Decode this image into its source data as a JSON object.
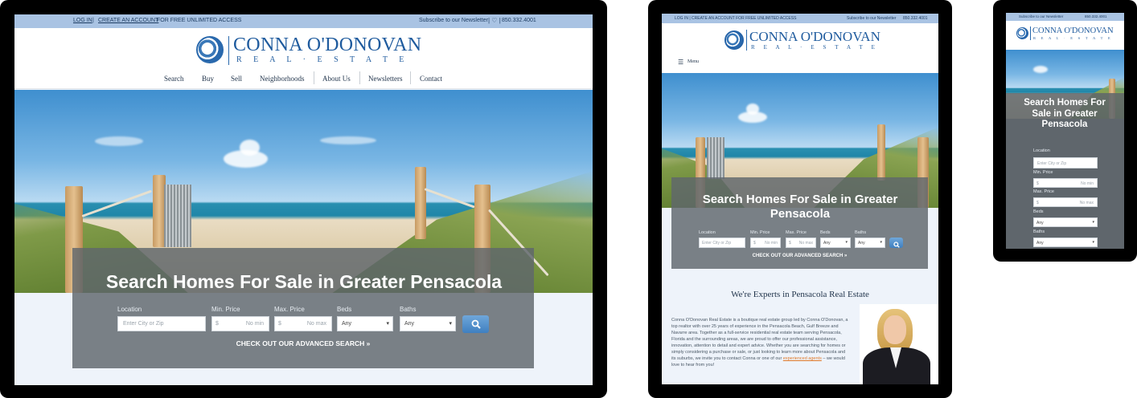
{
  "topbar": {
    "login": "LOG IN",
    "create_account": "CREATE AN ACCOUNT",
    "unlimited": "FOR FREE UNLIMITED ACCESS",
    "newsletter": "Subscribe to our Newsletter",
    "phone": "850.332.4001",
    "mobile_combined": "LOG IN | CREATE AN ACCOUNT FOR FREE UNLIMITED ACCESS"
  },
  "logo": {
    "name": "CONNA O'DONOVAN",
    "sub": "R E A L · E S T A T E"
  },
  "nav": [
    "Search",
    "Buy",
    "Sell",
    "Neighborhoods",
    "About Us",
    "Newsletters",
    "Contact"
  ],
  "menu_label": "Menu",
  "search": {
    "title": "Search Homes For Sale in Greater Pensacola",
    "location_label": "Location",
    "location_placeholder": "Enter City or Zip",
    "min_label": "Min. Price",
    "max_label": "Max. Price",
    "min_placeholder": "No min",
    "max_placeholder": "No max",
    "dollar": "$",
    "beds_label": "Beds",
    "baths_label": "Baths",
    "any": "Any",
    "advanced": "CHECK OUT OUR ADVANCED SEARCH »"
  },
  "experts": {
    "heading": "We're Experts in Pensacola Real Estate",
    "body": "Conna O'Donovan Real Estate is a boutique real estate group led by Conna O'Donovan, a top realtor with over 25 years of experience in the Pensacola Beach, Gulf Breeze and Navarre area. Together as a full-service residential real estate team serving Pensacola, Florida and the surrounding areas, we are proud to offer our professional assistance, innovation, attention to detail and expert advice. Whether you are searching for homes or simply considering a purchase or sale, or just looking to learn more about Pensacola and its suburbs, we invite you to contact Conna or one of our",
    "link": "experienced agents",
    "tail": "– we would love to hear from you!"
  },
  "colors": {
    "brand": "#1f5b9e",
    "topbar": "#a9c3e3",
    "panel": "#5f666c",
    "button": "#4f8fcc",
    "link": "#e07a2a"
  }
}
